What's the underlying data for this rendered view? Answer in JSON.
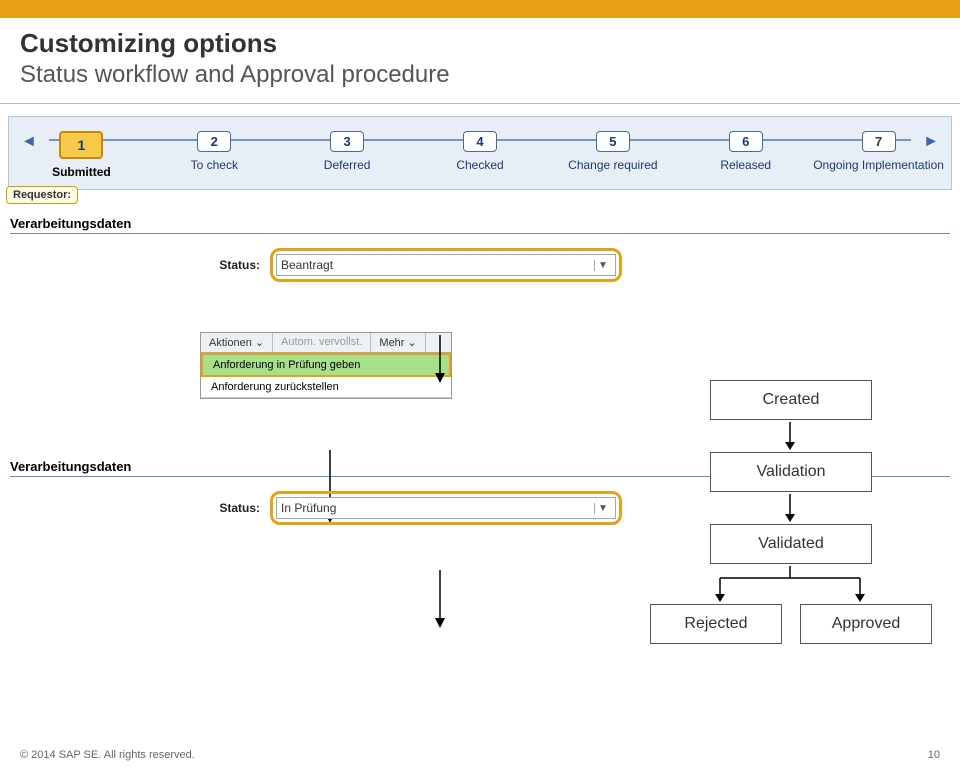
{
  "header": {
    "title": "Customizing options",
    "subtitle": "Status workflow and Approval procedure"
  },
  "steps": {
    "requestor_label": "Requestor:",
    "items": [
      {
        "num": "1",
        "label": "Submitted",
        "active": true
      },
      {
        "num": "2",
        "label": "To check"
      },
      {
        "num": "3",
        "label": "Deferred"
      },
      {
        "num": "4",
        "label": "Checked"
      },
      {
        "num": "5",
        "label": "Change required"
      },
      {
        "num": "6",
        "label": "Released"
      },
      {
        "num": "7",
        "label": "Ongoing Implementation"
      }
    ]
  },
  "section1": {
    "title": "Verarbeitungsdaten",
    "status_label": "Status:",
    "status_value": "Beantragt"
  },
  "menu": {
    "toolbar": {
      "actions": "Aktionen ⌄",
      "auto": "Autom. vervollst.",
      "more": "Mehr ⌄"
    },
    "item1": "Anforderung in Prüfung geben",
    "item2": "Anforderung zurückstellen"
  },
  "section2": {
    "title": "Verarbeitungsdaten",
    "status_label": "Status:",
    "status_value": "In Prüfung"
  },
  "flow": {
    "created": "Created",
    "validation": "Validation",
    "validated": "Validated",
    "rejected": "Rejected",
    "approved": "Approved"
  },
  "footer": {
    "copyright": "© 2014 SAP SE. All rights reserved.",
    "page": "10"
  }
}
